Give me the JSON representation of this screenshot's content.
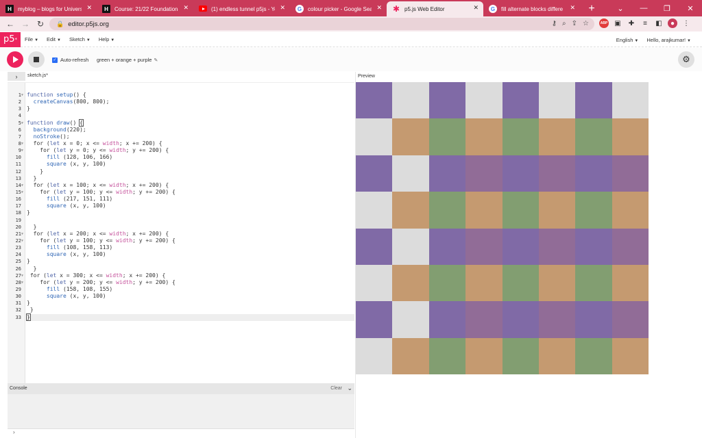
{
  "browser": {
    "tabs": [
      {
        "label": "myblog – blogs for Univers",
        "favicon": "h-icon",
        "active": false
      },
      {
        "label": "Course: 21/22 Foundational",
        "favicon": "h-icon",
        "active": false
      },
      {
        "label": "(1) endless tunnel p5js - You",
        "favicon": "youtube-icon",
        "active": false
      },
      {
        "label": "colour picker - Google Sear",
        "favicon": "google-icon",
        "active": false
      },
      {
        "label": "p5.js Web Editor",
        "favicon": "p5-asterisk-icon",
        "active": true
      },
      {
        "label": "fill alternate blocks differe",
        "favicon": "google-icon",
        "active": false
      }
    ],
    "url": "editor.p5js.org"
  },
  "p5": {
    "logo": "p5",
    "logo_sup": "*",
    "menu": [
      "File",
      "Edit",
      "Sketch",
      "Help"
    ],
    "language": "English",
    "user": "Hello, arajkumar!",
    "auto_refresh_label": "Auto-refresh",
    "sketch_name": "green + orange + purple",
    "file_name": "sketch.js",
    "file_modified_mark": "*",
    "preview_label": "Preview",
    "console_label": "Console",
    "clear_label": "Clear",
    "console_prompt": "›"
  },
  "code_lines": [
    "",
    "function setup() {",
    "  createCanvas(800, 800);",
    "}",
    "",
    "function draw() {",
    "  background(220);",
    "  noStroke();",
    "  for (let x = 0; x <= width; x += 200) {",
    "    for (let y = 0; y <= width; y += 200) {",
    "      fill (128, 106, 166)",
    "      square (x, y, 100)",
    "    }",
    "  }",
    "  for (let x = 100; x <= width; x += 200) {",
    "    for (let y = 100; y <= width; y += 200) {",
    "      fill (217, 151, 111)",
    "      square (x, y, 100)",
    "}",
    "",
    "  }",
    "  for (let x = 200; x <= width; x += 200) {",
    "    for (let y = 100; y <= width; y += 200) {",
    "      fill (108, 158, 113)",
    "      square (x, y, 100)",
    "}",
    "  }",
    " for (let x = 300; x <= width; x += 200) {",
    "    for (let y = 200; y <= width; y += 200) {",
    "      fill (158, 108, 155)",
    "      square (x, y, 100)",
    "}",
    " }",
    "}"
  ],
  "fold_lines": [
    1,
    5,
    8,
    9,
    14,
    15,
    21,
    22,
    27,
    28
  ],
  "current_line": 33,
  "colors": {
    "background": "#dcdcdc",
    "purple": "#806aa6",
    "orange": "#c59a70",
    "green": "#829e71",
    "mauve": "#916c97",
    "p5_pink": "#ed225d",
    "tab_bar": "#c93a59"
  },
  "canvas_grid": [
    [
      "purple",
      "background",
      "purple",
      "background",
      "purple",
      "background",
      "purple",
      "background"
    ],
    [
      "background",
      "orange",
      "green",
      "orange",
      "green",
      "orange",
      "green",
      "orange"
    ],
    [
      "purple",
      "background",
      "purple",
      "mauve",
      "purple",
      "mauve",
      "purple",
      "mauve"
    ],
    [
      "background",
      "orange",
      "green",
      "orange",
      "green",
      "orange",
      "green",
      "orange"
    ],
    [
      "purple",
      "background",
      "purple",
      "mauve",
      "purple",
      "mauve",
      "purple",
      "mauve"
    ],
    [
      "background",
      "orange",
      "green",
      "orange",
      "green",
      "orange",
      "green",
      "orange"
    ],
    [
      "purple",
      "background",
      "purple",
      "mauve",
      "purple",
      "mauve",
      "purple",
      "mauve"
    ],
    [
      "background",
      "orange",
      "green",
      "orange",
      "green",
      "orange",
      "green",
      "orange"
    ]
  ]
}
